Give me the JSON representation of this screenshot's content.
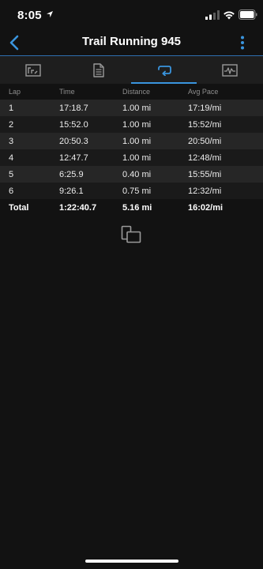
{
  "status_bar": {
    "time": "8:05"
  },
  "nav": {
    "title": "Trail Running 945"
  },
  "tabs": [
    {
      "icon": "stats-chart-icon",
      "active": false
    },
    {
      "icon": "document-icon",
      "active": false
    },
    {
      "icon": "laps-loop-icon",
      "active": true
    },
    {
      "icon": "waveform-icon",
      "active": false
    }
  ],
  "table": {
    "headers": {
      "lap": "Lap",
      "time": "Time",
      "distance": "Distance",
      "avg_pace": "Avg Pace"
    },
    "rows": [
      {
        "lap": "1",
        "time": "17:18.7",
        "distance": "1.00 mi",
        "avg_pace": "17:19/mi"
      },
      {
        "lap": "2",
        "time": "15:52.0",
        "distance": "1.00 mi",
        "avg_pace": "15:52/mi"
      },
      {
        "lap": "3",
        "time": "20:50.3",
        "distance": "1.00 mi",
        "avg_pace": "20:50/mi"
      },
      {
        "lap": "4",
        "time": "12:47.7",
        "distance": "1.00 mi",
        "avg_pace": "12:48/mi"
      },
      {
        "lap": "5",
        "time": "6:25.9",
        "distance": "0.40 mi",
        "avg_pace": "15:55/mi"
      },
      {
        "lap": "6",
        "time": "9:26.1",
        "distance": "0.75 mi",
        "avg_pace": "12:32/mi"
      }
    ],
    "total": {
      "lap": "Total",
      "time": "1:22:40.7",
      "distance": "5.16 mi",
      "avg_pace": "16:02/mi"
    }
  },
  "colors": {
    "background": "#121212",
    "accent": "#3a95de",
    "tab_bar": "#1e1e1e",
    "row_even": "#262626",
    "row_odd": "#1a1a1a",
    "header_text": "#8d8d8d"
  }
}
